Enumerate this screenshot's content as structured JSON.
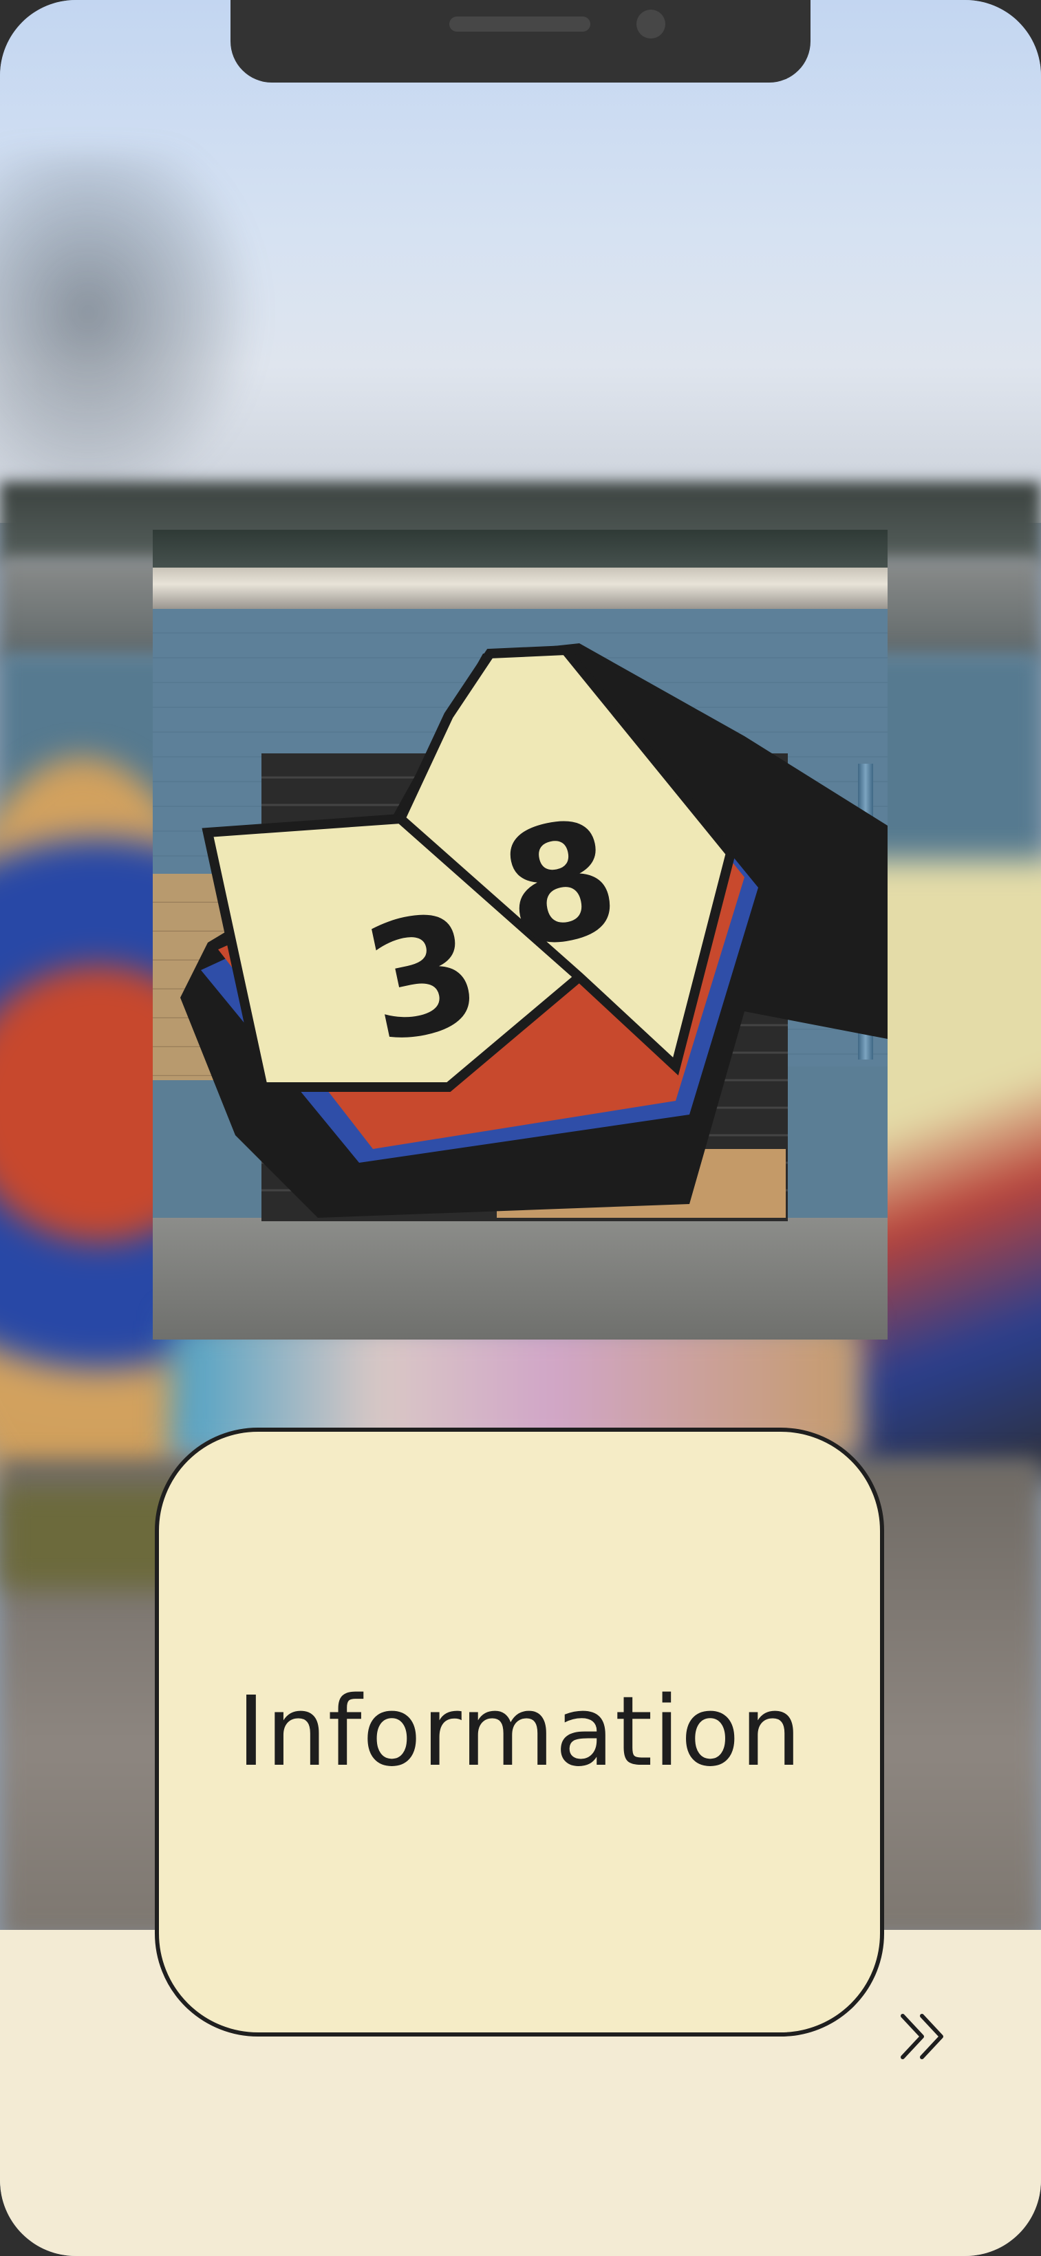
{
  "card": {
    "label": "Information"
  },
  "mural": {
    "number_left": "3",
    "number_right": "8"
  },
  "navigation": {
    "next_icon": "double-chevron-right-icon"
  },
  "colors": {
    "card_background": "#f5ecc6",
    "bottom_panel": "#f3ebd4",
    "card_border": "#1f1f1f"
  }
}
